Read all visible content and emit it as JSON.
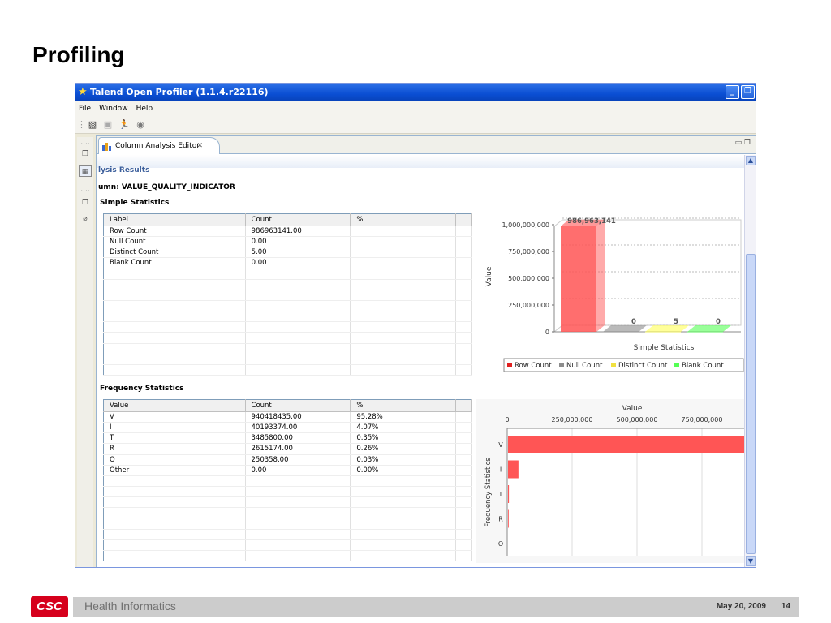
{
  "slide": {
    "title": "Profiling"
  },
  "app": {
    "title": "Talend Open Profiler (1.1.4.r22116)",
    "menu": [
      "File",
      "Window",
      "Help"
    ],
    "tab_label": "Column Analysis Editor",
    "results_title": "lysis Results",
    "column_title": "umn: VALUE_QUALITY_INDICATOR"
  },
  "simple_statistics": {
    "title": "Simple Statistics",
    "headers": [
      "Label",
      "Count",
      "%"
    ],
    "rows": [
      [
        "Row Count",
        "986963141.00",
        ""
      ],
      [
        "Null Count",
        "0.00",
        ""
      ],
      [
        "Distinct Count",
        "5.00",
        ""
      ],
      [
        "Blank Count",
        "0.00",
        ""
      ]
    ]
  },
  "frequency_statistics": {
    "title": "Frequency Statistics",
    "headers": [
      "Value",
      "Count",
      "%"
    ],
    "rows": [
      [
        "V",
        "940418435.00",
        "95.28%"
      ],
      [
        "I",
        "40193374.00",
        "4.07%"
      ],
      [
        "T",
        "3485800.00",
        "0.35%"
      ],
      [
        "R",
        "2615174.00",
        "0.26%"
      ],
      [
        "O",
        "250358.00",
        "0.03%"
      ],
      [
        "Other",
        "0.00",
        "0.00%"
      ]
    ]
  },
  "chart_data": [
    {
      "type": "bar",
      "xlabel": "Simple Statistics",
      "ylabel": "Value",
      "categories": [
        "Row Count",
        "Null Count",
        "Distinct Count",
        "Blank Count"
      ],
      "values": [
        986963141,
        0,
        5,
        0
      ],
      "data_labels": [
        "986,963,141",
        "0",
        "5",
        "0"
      ],
      "colors": [
        "#ff5555",
        "#8c8c8c",
        "#ffff55",
        "#55ff55"
      ],
      "ylim": [
        0,
        1000000000
      ],
      "yticks": [
        "0",
        "250,000,000",
        "500,000,000",
        "750,000,000",
        "1,000,000,000"
      ],
      "legend": [
        "Row Count",
        "Null Count",
        "Distinct Count",
        "Blank Count"
      ],
      "legend_position": "bottom"
    },
    {
      "type": "bar",
      "orientation": "horizontal",
      "xlabel": "Value",
      "ylabel": "Frequency Statistics",
      "categories": [
        "V",
        "I",
        "T",
        "R",
        "O"
      ],
      "values": [
        940418435,
        40193374,
        3485800,
        2615174,
        250358
      ],
      "color": "#ff5555",
      "xticks": [
        "0",
        "250,000,000",
        "500,000,000",
        "750,000,000"
      ]
    }
  ],
  "footer": {
    "left": "Health Informatics",
    "date": "May 20, 2009",
    "page": "14",
    "logo": "CSC"
  }
}
